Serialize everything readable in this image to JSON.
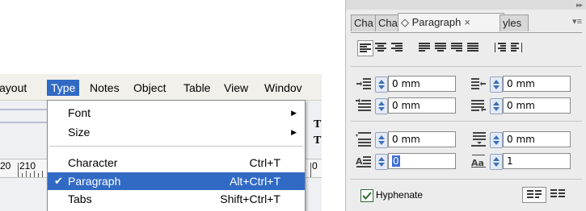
{
  "menubar": {
    "items": [
      {
        "label": "ayout"
      },
      {
        "label": "Type"
      },
      {
        "label": "Notes"
      },
      {
        "label": "Object"
      },
      {
        "label": "Table"
      },
      {
        "label": "View"
      },
      {
        "label": "Windov"
      }
    ]
  },
  "type_menu": {
    "items": [
      {
        "label": "Font",
        "shortcut": "",
        "submenu": true
      },
      {
        "label": "Size",
        "shortcut": "",
        "submenu": true
      },
      {
        "label": "Character",
        "shortcut": "Ctrl+T"
      },
      {
        "label": "Paragraph",
        "shortcut": "Alt+Ctrl+T",
        "checked": true,
        "highlighted": true
      },
      {
        "label": "Tabs",
        "shortcut": "Shift+Ctrl+T"
      }
    ],
    "check_glyph": "✔",
    "submenu_glyph": "▶"
  },
  "ruler": {
    "labels": [
      "20",
      "210",
      "0"
    ]
  },
  "doc": {
    "t_glyph": "T"
  },
  "panel": {
    "tabs": [
      {
        "label": "Cha"
      },
      {
        "label": "Cha"
      },
      {
        "label": "◇ Paragraph",
        "close": "×",
        "active": true
      },
      {
        "label": "yles"
      }
    ],
    "grip": "▸▸",
    "menu_icon": "▾≡",
    "fields": {
      "left_indent": "0 mm",
      "right_indent": "0 mm",
      "first_line_indent": "0 mm",
      "last_line_indent": "0 mm",
      "space_before": "0 mm",
      "space_after": "0 mm",
      "drop_cap_lines": "0",
      "drop_cap_chars": "1"
    },
    "hyphenate": {
      "label": "Hyphenate",
      "checked": true
    }
  },
  "colors": {
    "menu_highlight": "#316ac5",
    "spinner_blue": "#3b6fb6",
    "checkbox_green": "#2e6a2e"
  }
}
